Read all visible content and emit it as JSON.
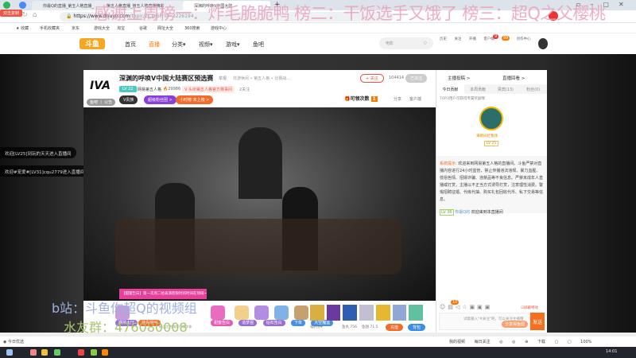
{
  "browser": {
    "tabs": [
      "你最Q的直播_第五人格直播_",
      "第五人格直播_第五人格直播精彩",
      "深渊的呼唤V中国大陆"
    ],
    "new_tab": "+",
    "url_host": "https://www.douyu.com",
    "url_path": "/topic/ZCDJS?rid=3226194",
    "badge": "双击复制",
    "bookmarks": [
      "收藏",
      "手机收藏夹",
      "京东",
      "游戏大全",
      "淘宝",
      "谷歌",
      "网址大全",
      "360搜索",
      "游戏中心"
    ],
    "status_left": "今日优选",
    "status_right": [
      "我的视频",
      "每日关注",
      "下载",
      "100%"
    ]
  },
  "overlay": {
    "banner": "感谢上周榜一：炸毛脆脆鸭 榜二：干饭选手又饿了 榜三：超Q之父樱桃",
    "bili": "b站：斗鱼你超Q的视频组",
    "qq": "水友群：476080008"
  },
  "header": {
    "nav": [
      "首页",
      "直播",
      "分类▾",
      "视频▾",
      "游戏▾",
      "鱼吧"
    ],
    "search_placeholder": "电影",
    "icons": [
      "历史",
      "关注",
      "开播",
      "客户端",
      "消息",
      "创作中心"
    ],
    "msg_badge": "9",
    "notif_badge": "99"
  },
  "room": {
    "title": "深渊的呼唤V中国大陆赛区预选赛",
    "report": "举报",
    "breadcrumb": "非游休闲 • 第五人格 • 比赛战...",
    "level": "LV 22",
    "category": "网易第五人格",
    "heat": "29986",
    "rank": "V 头衔第五人格官方赛事间",
    "fans": "2关注",
    "follow": "+ 关注",
    "follow_count": "104414",
    "subscribed": "已关注",
    "logo_label": "鱼吧 丨 公告",
    "vip": "V贵族",
    "fan_badge": "超级粉丝团 >",
    "hour_rank": "小时榜 未上榜 >",
    "claim": "可领次数",
    "claim_count": "1",
    "share": "分享",
    "client": "客户端"
  },
  "right": {
    "top_links": [
      "主播投稿 >",
      "直播回看 >"
    ],
    "tabs": [
      "今日贡献",
      "本周贡献",
      "贵宾(13)",
      "粉丝(0)"
    ],
    "hint": "TOP3用户可获得专属奖励哦",
    "top_user": "来瞬间赶我戏",
    "top_level": "LV 25",
    "system_label": "系统提示:",
    "system_msg": "欢迎来到网易第五人格的直播间。斗鱼严禁对直播内容进行24小时监管，禁止传播违法违规、暴力血腥、低俗色情、招嫖诈骗、违禁品等不良信息。严禁未成年人直播或打赏，主播以不正当方式诱导打赏，注意理性消费。警惕招聘征婚、代练代抽、购买礼包回收代币、私下交易等信息。",
    "chat_level": "LV 36",
    "chat_user": "你最Q的",
    "chat_msg": "欢迎来到本直播间",
    "shield": "屏蔽特效",
    "input_placeholder": "试着输入\"#关注\"吧，可以关注主播哦",
    "input_tag": "分享得鱼翅",
    "send": "发送",
    "chat_badge": "10"
  },
  "welcome": [
    "欢迎[LV25]到玩的天天进入直播间",
    "欢迎#宠爱#[LV31]cqu2779进入直播间"
  ],
  "gifts": {
    "promo": "【甜蜜告白】第一次周二给表演而限时的时间在场域~",
    "items": [
      "钢琴大厅",
      "能先呼叫",
      "甜蜜告白",
      "造梦屋",
      "钻石告白",
      "下单",
      "大空魔盒"
    ],
    "fish": "鱼丸 756",
    "fishbar": "鱼翅 71.5",
    "welfare": "福利券▾",
    "recharge": "充值",
    "backpack": "背包",
    "fans_hint": "粉丝团 专属好礼等你拿"
  },
  "taskbar": {
    "time": "14:01"
  }
}
